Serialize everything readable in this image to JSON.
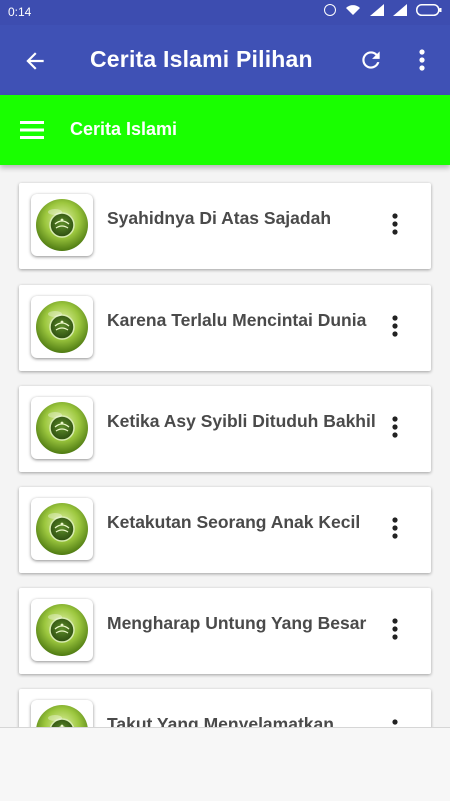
{
  "status_bar": {
    "time": "0:14",
    "icons": [
      "alarm-icon",
      "wifi-icon",
      "signal-icon",
      "signal-icon",
      "battery-icon"
    ]
  },
  "app_bar": {
    "title": "Cerita Islami Pilihan",
    "icons": [
      "back-arrow-icon",
      "refresh-icon",
      "more-vert-icon"
    ],
    "color": "#3f51b5"
  },
  "nav_bar": {
    "title": "Cerita Islami",
    "icon": "hamburger-menu-icon",
    "color": "#19ff00"
  },
  "list": {
    "items": [
      {
        "title": "Syahidnya Di Atas Sajadah"
      },
      {
        "title": "Karena Terlalu Mencintai Dunia"
      },
      {
        "title": "Ketika Asy Syibli Dituduh Bakhil"
      },
      {
        "title": "Ketakutan Seorang Anak Kecil"
      },
      {
        "title": "Mengharap Untung Yang Besar"
      },
      {
        "title": "Takut Yang Menyelamatkan"
      }
    ],
    "item_icon": "quran-emblem-icon",
    "item_menu_icon": "more-vert-icon"
  }
}
